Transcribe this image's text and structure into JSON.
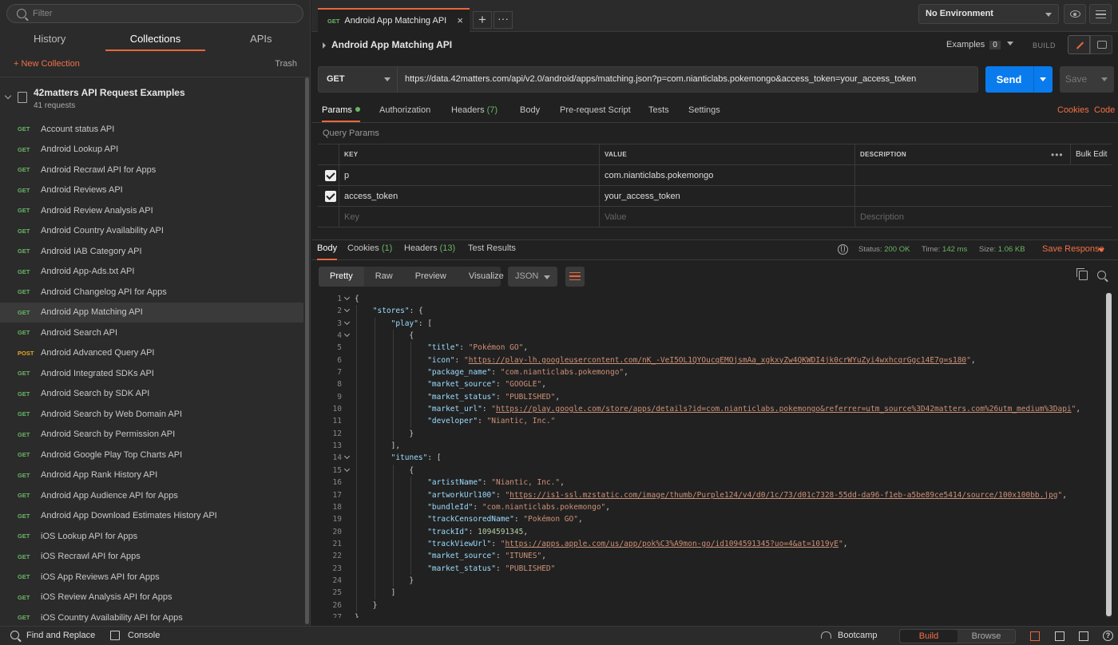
{
  "sidebar": {
    "search_placeholder": "Filter",
    "tabs": [
      "History",
      "Collections",
      "APIs"
    ],
    "new_collection": "+ New Collection",
    "trash": "Trash",
    "collection": {
      "name": "42matters API Request Examples",
      "count": "41 requests"
    },
    "requests": [
      {
        "method": "GET",
        "name": "Account status API"
      },
      {
        "method": "GET",
        "name": "Android Lookup API"
      },
      {
        "method": "GET",
        "name": "Android Recrawl API for Apps"
      },
      {
        "method": "GET",
        "name": "Android Reviews API"
      },
      {
        "method": "GET",
        "name": "Android Review Analysis API"
      },
      {
        "method": "GET",
        "name": "Android Country Availability API"
      },
      {
        "method": "GET",
        "name": "Android IAB Category API"
      },
      {
        "method": "GET",
        "name": "Android App-Ads.txt API"
      },
      {
        "method": "GET",
        "name": "Android Changelog API for Apps"
      },
      {
        "method": "GET",
        "name": "Android App Matching API",
        "active": true
      },
      {
        "method": "GET",
        "name": "Android Search API"
      },
      {
        "method": "POST",
        "name": "Android Advanced Query API"
      },
      {
        "method": "GET",
        "name": "Android Integrated SDKs API"
      },
      {
        "method": "GET",
        "name": "Android Search by SDK API"
      },
      {
        "method": "GET",
        "name": "Android Search by Web Domain API"
      },
      {
        "method": "GET",
        "name": "Android Search by Permission API"
      },
      {
        "method": "GET",
        "name": "Android Google Play Top Charts API"
      },
      {
        "method": "GET",
        "name": "Android App Rank History API"
      },
      {
        "method": "GET",
        "name": "Android App Audience API for Apps"
      },
      {
        "method": "GET",
        "name": "Android App Download Estimates History API"
      },
      {
        "method": "GET",
        "name": "iOS Lookup API for Apps"
      },
      {
        "method": "GET",
        "name": "iOS Recrawl API for Apps"
      },
      {
        "method": "GET",
        "name": "iOS App Reviews API for Apps"
      },
      {
        "method": "GET",
        "name": "iOS Review Analysis API for Apps"
      },
      {
        "method": "GET",
        "name": "iOS Country Availability API for Apps"
      }
    ]
  },
  "topbar": {
    "tab": {
      "method": "GET",
      "title": "Android App Matching API",
      "close": "×"
    },
    "plus": "+",
    "more": "···",
    "environment": "No Environment"
  },
  "request": {
    "title": "Android App Matching API",
    "examples_label": "Examples",
    "examples_count": "0",
    "build_label": "BUILD",
    "method": "GET",
    "url": "https://data.42matters.com/api/v2.0/android/apps/matching.json?p=com.nianticlabs.pokemongo&access_token=your_access_token",
    "send": "Send",
    "save": "Save",
    "tabs": {
      "params": "Params",
      "authorization": "Authorization",
      "headers": "Headers",
      "headers_count": "(7)",
      "body": "Body",
      "prerequest": "Pre-request Script",
      "tests": "Tests",
      "settings": "Settings",
      "cookies": "Cookies",
      "code": "Code"
    },
    "query_params_label": "Query Params",
    "table": {
      "headers": {
        "key": "KEY",
        "value": "VALUE",
        "description": "DESCRIPTION",
        "more": "•••",
        "bulk_edit": "Bulk Edit"
      },
      "rows": [
        {
          "key": "p",
          "value": "com.nianticlabs.pokemongo"
        },
        {
          "key": "access_token",
          "value": "your_access_token"
        }
      ],
      "placeholder": {
        "key": "Key",
        "value": "Value",
        "description": "Description"
      }
    }
  },
  "response": {
    "tabs": {
      "body": "Body",
      "cookies": "Cookies",
      "cookies_count": "(1)",
      "headers": "Headers",
      "headers_count": "(13)",
      "test_results": "Test Results"
    },
    "status_label": "Status:",
    "status": "200 OK",
    "time_label": "Time:",
    "time": "142 ms",
    "size_label": "Size:",
    "size": "1.06 KB",
    "save_response": "Save Response",
    "view_tabs": [
      "Pretty",
      "Raw",
      "Preview",
      "Visualize"
    ],
    "format": "JSON"
  },
  "code_lines": [
    {
      "n": "1",
      "fold": true,
      "i": 0,
      "parts": [
        [
          "p",
          "{"
        ]
      ]
    },
    {
      "n": "2",
      "fold": true,
      "i": 1,
      "parts": [
        [
          "k",
          "\"stores\""
        ],
        [
          "p",
          ": {"
        ]
      ]
    },
    {
      "n": "3",
      "fold": true,
      "i": 2,
      "parts": [
        [
          "k",
          "\"play\""
        ],
        [
          "p",
          ": ["
        ]
      ]
    },
    {
      "n": "4",
      "fold": true,
      "i": 3,
      "parts": [
        [
          "p",
          "{"
        ]
      ]
    },
    {
      "n": "5",
      "i": 4,
      "parts": [
        [
          "k",
          "\"title\""
        ],
        [
          "p",
          ": "
        ],
        [
          "s",
          "\"Pokémon GO\""
        ],
        [
          "p",
          ","
        ]
      ]
    },
    {
      "n": "6",
      "i": 4,
      "parts": [
        [
          "k",
          "\"icon\""
        ],
        [
          "p",
          ": "
        ],
        [
          "s",
          "\""
        ],
        [
          "u",
          "https://play-lh.googleusercontent.com/nK_-VeI5OL1QYOucqEMOjsmAa_xgkxyZw4QKWDI4jk0crWYuZyi4wxhcqrGgc14E7g=s180"
        ],
        [
          "s",
          "\""
        ],
        [
          "p",
          ","
        ]
      ]
    },
    {
      "n": "7",
      "i": 4,
      "parts": [
        [
          "k",
          "\"package_name\""
        ],
        [
          "p",
          ": "
        ],
        [
          "s",
          "\"com.nianticlabs.pokemongo\""
        ],
        [
          "p",
          ","
        ]
      ]
    },
    {
      "n": "8",
      "i": 4,
      "parts": [
        [
          "k",
          "\"market_source\""
        ],
        [
          "p",
          ": "
        ],
        [
          "s",
          "\"GOOGLE\""
        ],
        [
          "p",
          ","
        ]
      ]
    },
    {
      "n": "9",
      "i": 4,
      "parts": [
        [
          "k",
          "\"market_status\""
        ],
        [
          "p",
          ": "
        ],
        [
          "s",
          "\"PUBLISHED\""
        ],
        [
          "p",
          ","
        ]
      ]
    },
    {
      "n": "10",
      "i": 4,
      "parts": [
        [
          "k",
          "\"market_url\""
        ],
        [
          "p",
          ": "
        ],
        [
          "s",
          "\""
        ],
        [
          "u",
          "https://play.google.com/store/apps/details?id=com.nianticlabs.pokemongo&referrer=utm_source%3D42matters.com%26utm_medium%3Dapi"
        ],
        [
          "s",
          "\""
        ],
        [
          "p",
          ","
        ]
      ]
    },
    {
      "n": "11",
      "i": 4,
      "parts": [
        [
          "k",
          "\"developer\""
        ],
        [
          "p",
          ": "
        ],
        [
          "s",
          "\"Niantic, Inc.\""
        ]
      ]
    },
    {
      "n": "12",
      "i": 3,
      "parts": [
        [
          "p",
          "}"
        ]
      ]
    },
    {
      "n": "13",
      "i": 2,
      "parts": [
        [
          "p",
          "],"
        ]
      ]
    },
    {
      "n": "14",
      "fold": true,
      "i": 2,
      "parts": [
        [
          "k",
          "\"itunes\""
        ],
        [
          "p",
          ": ["
        ]
      ]
    },
    {
      "n": "15",
      "fold": true,
      "i": 3,
      "parts": [
        [
          "p",
          "{"
        ]
      ]
    },
    {
      "n": "16",
      "i": 4,
      "parts": [
        [
          "k",
          "\"artistName\""
        ],
        [
          "p",
          ": "
        ],
        [
          "s",
          "\"Niantic, Inc.\""
        ],
        [
          "p",
          ","
        ]
      ]
    },
    {
      "n": "17",
      "i": 4,
      "parts": [
        [
          "k",
          "\"artworkUrl100\""
        ],
        [
          "p",
          ": "
        ],
        [
          "s",
          "\""
        ],
        [
          "u",
          "https://is1-ssl.mzstatic.com/image/thumb/Purple124/v4/d0/1c/73/d01c7328-55dd-da96-f1eb-a5be89ce5414/source/100x100bb.jpg"
        ],
        [
          "s",
          "\""
        ],
        [
          "p",
          ","
        ]
      ]
    },
    {
      "n": "18",
      "i": 4,
      "parts": [
        [
          "k",
          "\"bundleId\""
        ],
        [
          "p",
          ": "
        ],
        [
          "s",
          "\"com.nianticlabs.pokemongo\""
        ],
        [
          "p",
          ","
        ]
      ]
    },
    {
      "n": "19",
      "i": 4,
      "parts": [
        [
          "k",
          "\"trackCensoredName\""
        ],
        [
          "p",
          ": "
        ],
        [
          "s",
          "\"Pokémon GO\""
        ],
        [
          "p",
          ","
        ]
      ]
    },
    {
      "n": "20",
      "i": 4,
      "parts": [
        [
          "k",
          "\"trackId\""
        ],
        [
          "p",
          ": "
        ],
        [
          "n",
          "1094591345"
        ],
        [
          "p",
          ","
        ]
      ]
    },
    {
      "n": "21",
      "i": 4,
      "parts": [
        [
          "k",
          "\"trackViewUrl\""
        ],
        [
          "p",
          ": "
        ],
        [
          "s",
          "\""
        ],
        [
          "u",
          "https://apps.apple.com/us/app/pok%C3%A9mon-go/id1094591345?uo=4&at=1019yE"
        ],
        [
          "s",
          "\""
        ],
        [
          "p",
          ","
        ]
      ]
    },
    {
      "n": "22",
      "i": 4,
      "parts": [
        [
          "k",
          "\"market_source\""
        ],
        [
          "p",
          ": "
        ],
        [
          "s",
          "\"ITUNES\""
        ],
        [
          "p",
          ","
        ]
      ]
    },
    {
      "n": "23",
      "i": 4,
      "parts": [
        [
          "k",
          "\"market_status\""
        ],
        [
          "p",
          ": "
        ],
        [
          "s",
          "\"PUBLISHED\""
        ]
      ]
    },
    {
      "n": "24",
      "i": 3,
      "parts": [
        [
          "p",
          "}"
        ]
      ]
    },
    {
      "n": "25",
      "i": 2,
      "parts": [
        [
          "p",
          "]"
        ]
      ]
    },
    {
      "n": "26",
      "i": 1,
      "parts": [
        [
          "p",
          "}"
        ]
      ]
    },
    {
      "n": "27",
      "i": 0,
      "parts": [
        [
          "p",
          "}"
        ]
      ]
    }
  ],
  "statusbar": {
    "find_replace": "Find and Replace",
    "console": "Console",
    "bootcamp": "Bootcamp",
    "build": "Build",
    "browse": "Browse",
    "help": "?"
  }
}
